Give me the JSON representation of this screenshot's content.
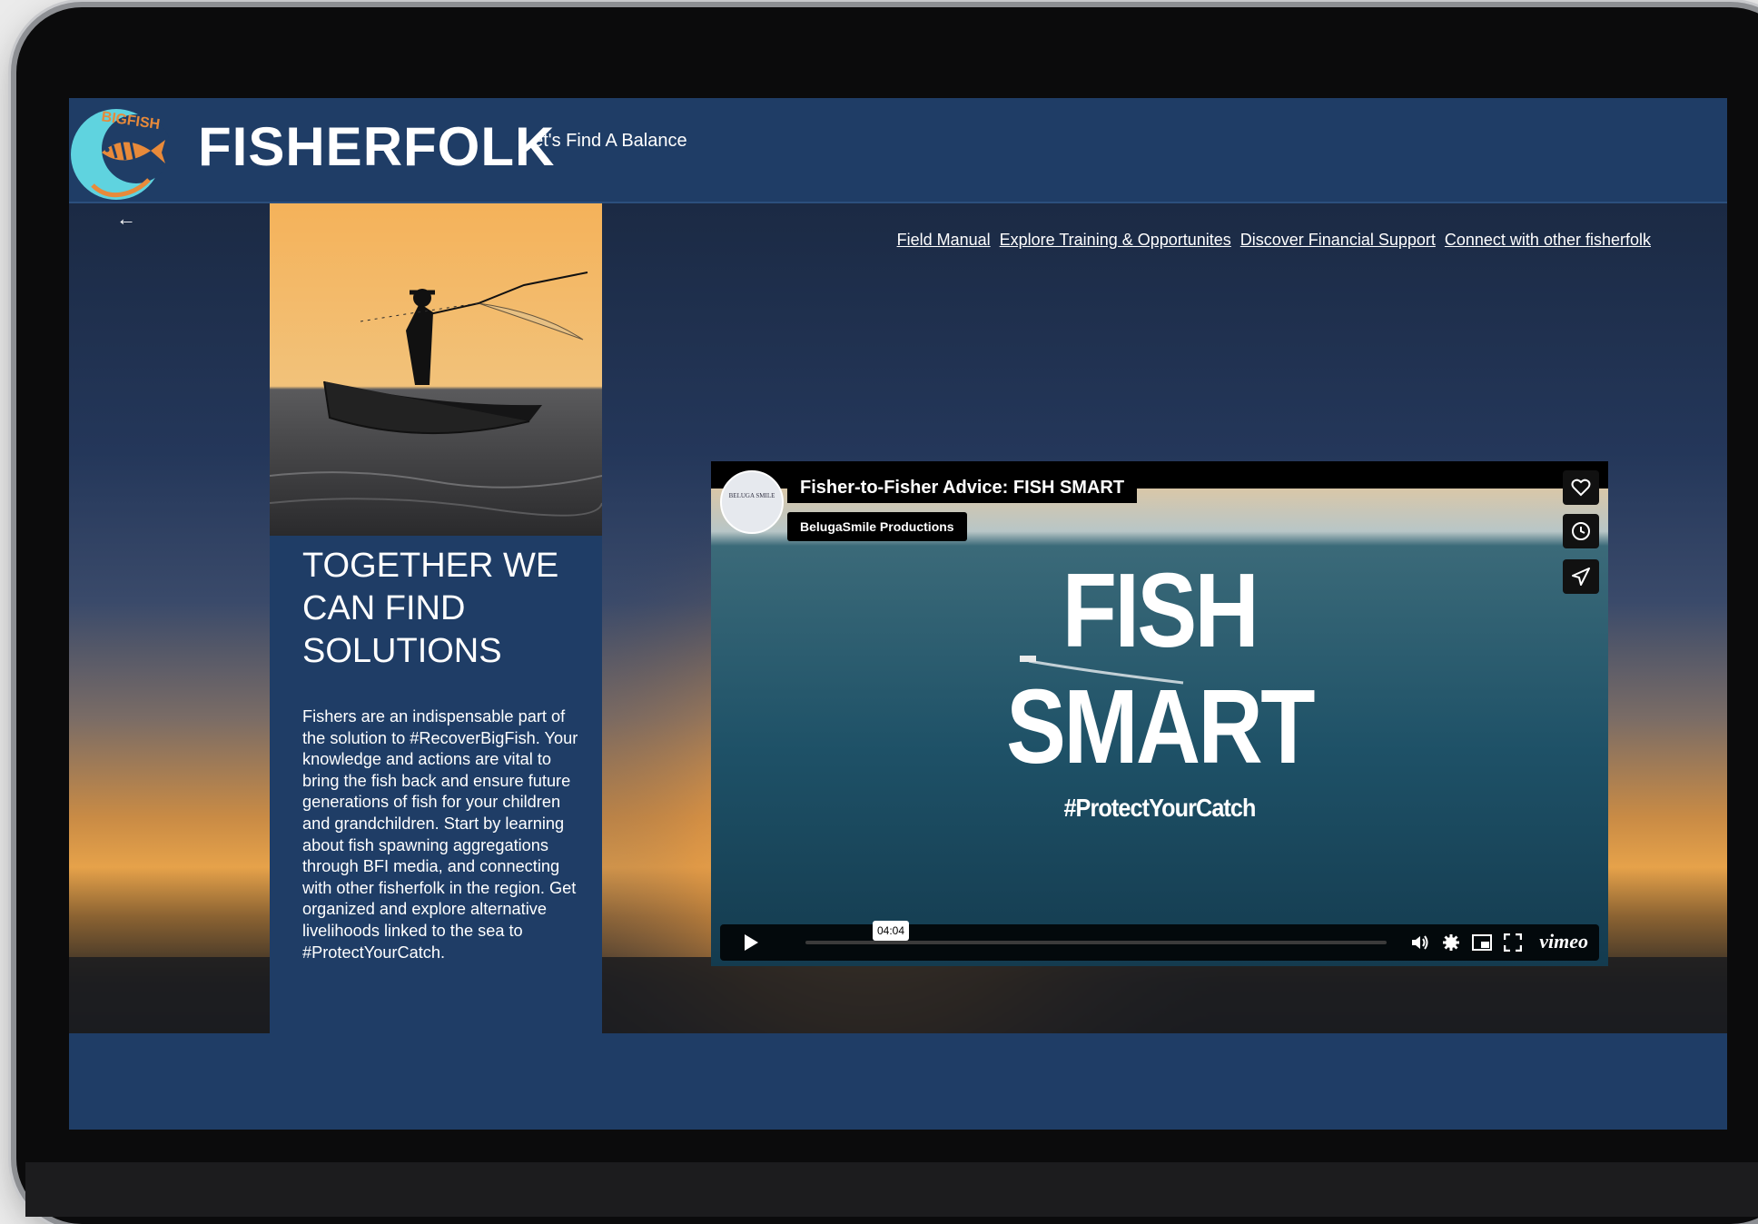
{
  "site": {
    "title": "FISHERFOLK",
    "tagline": "Let's Find A Balance",
    "back_arrow": "←"
  },
  "logo": {
    "text": "BIGFISH",
    "colors": {
      "circle": "#5fd3df",
      "accent": "#e88a3a"
    }
  },
  "nav": {
    "items": [
      {
        "label": "Field Manual"
      },
      {
        "label": "Explore Training & Opportunites"
      },
      {
        "label": "Discover Financial Support"
      },
      {
        "label": "Connect with other fisherfolk"
      }
    ]
  },
  "panel": {
    "heading": "TOGETHER WE CAN FIND SOLUTIONS",
    "body": "Fishers are an indispensable part of the solution to #RecoverBigFish. Your knowledge and actions are vital to bring the fish back and ensure future generations of fish for your children and grandchildren. Start by learning about fish spawning aggregations through BFI media, and connecting with other fisherfolk in the region. Get organized and explore alternative livelihoods linked to the sea to #ProtectYourCatch."
  },
  "video": {
    "title": "Fisher-to-Fisher Advice: FISH SMART",
    "byline": "BelugaSmile Productions",
    "avatar_text": "BELUGA SMILE",
    "overlay_line1": "FISH",
    "overlay_line2": "SMART",
    "overlay_hashtag": "#ProtectYourCatch",
    "duration": "04:04",
    "player_brand": "vimeo",
    "side_buttons": [
      "heart-icon",
      "clock-icon",
      "send-icon"
    ],
    "controls": [
      "play-icon",
      "volume-icon",
      "settings-icon",
      "pip-icon",
      "fullscreen-icon"
    ]
  },
  "colors": {
    "brand_blue": "#1f3d66",
    "text": "#ffffff",
    "sunset": "#e6a24a"
  }
}
